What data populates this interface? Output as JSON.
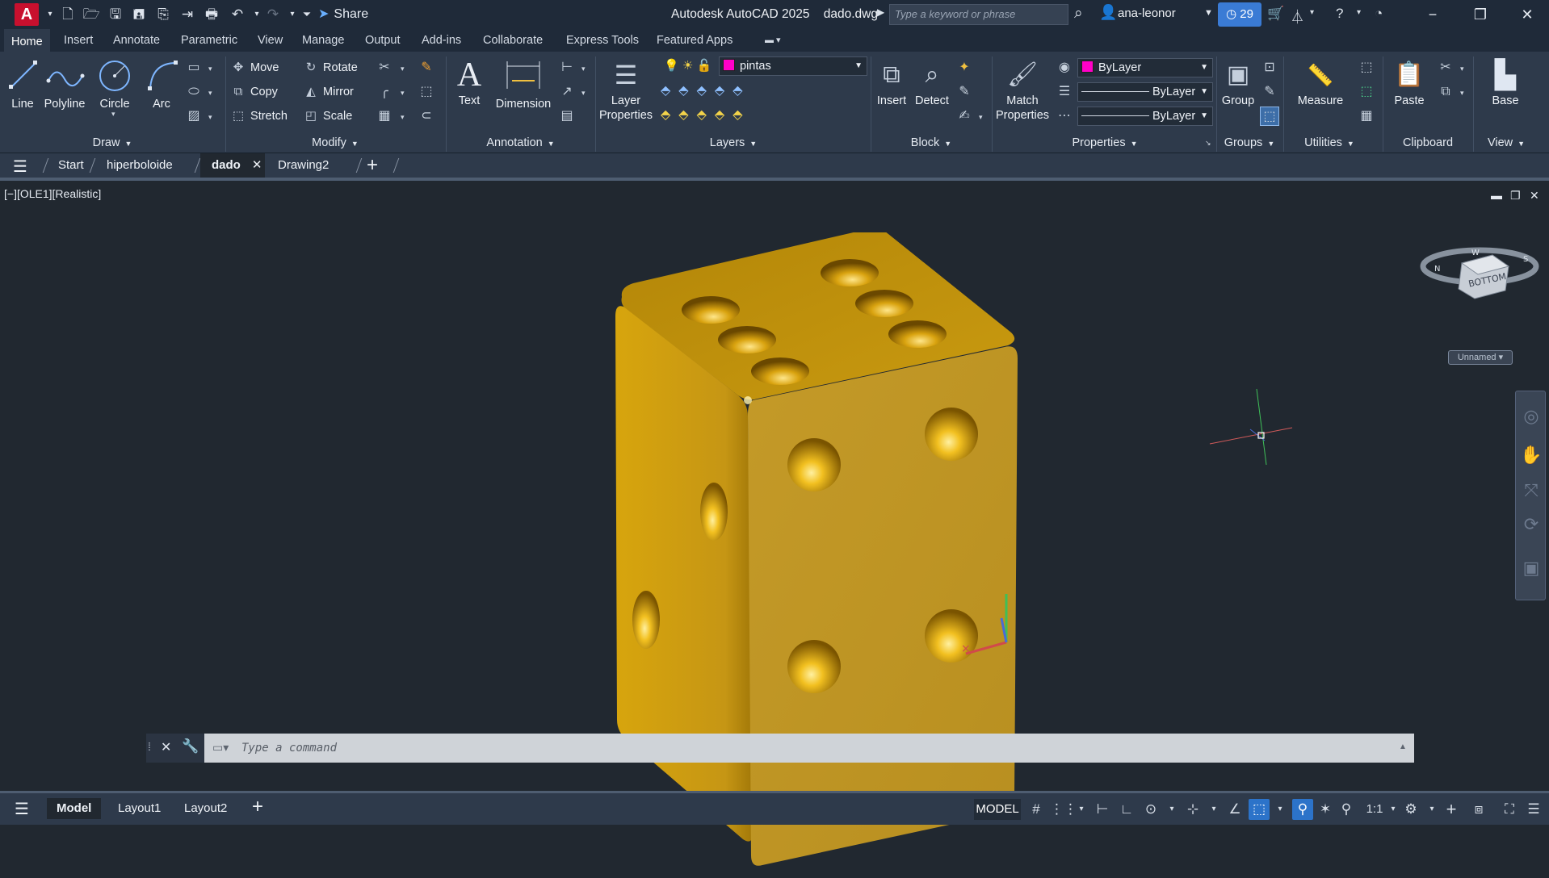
{
  "titlebar": {
    "app_letter": "A",
    "share_label": "Share",
    "app_name": "Autodesk AutoCAD 2025",
    "file_name": "dado.dwg",
    "search_placeholder": "Type a keyword or phrase",
    "user_name": "ana-leonor",
    "subscription_days": "29"
  },
  "ribbon_tabs": [
    "Home",
    "Insert",
    "Annotate",
    "Parametric",
    "View",
    "Manage",
    "Output",
    "Add-ins",
    "Collaborate",
    "Express Tools",
    "Featured Apps"
  ],
  "ribbon": {
    "draw": {
      "title": "Draw",
      "line": "Line",
      "polyline": "Polyline",
      "circle": "Circle",
      "arc": "Arc"
    },
    "modify": {
      "title": "Modify",
      "move": "Move",
      "rotate": "Rotate",
      "copy": "Copy",
      "mirror": "Mirror",
      "stretch": "Stretch",
      "scale": "Scale"
    },
    "annotation": {
      "title": "Annotation",
      "text": "Text",
      "dimension": "Dimension"
    },
    "layers": {
      "title": "Layers",
      "layer_properties_1": "Layer",
      "layer_properties_2": "Properties",
      "current_layer": "pintas",
      "layer_color": "#ff00c8"
    },
    "block": {
      "title": "Block",
      "insert": "Insert",
      "detect": "Detect"
    },
    "properties": {
      "title": "Properties",
      "match_1": "Match",
      "match_2": "Properties",
      "color": "ByLayer",
      "linetype": "ByLayer",
      "lineweight": "ByLayer"
    },
    "groups": {
      "title": "Groups",
      "group": "Group"
    },
    "utilities": {
      "title": "Utilities",
      "measure": "Measure"
    },
    "clipboard": {
      "title": "Clipboard",
      "paste": "Paste"
    },
    "view": {
      "title": "View",
      "base": "Base"
    }
  },
  "doc_tabs": {
    "start": "Start",
    "tab1": "hiperboloide",
    "tab2": "dado",
    "tab3": "Drawing2"
  },
  "viewport": {
    "label": "[−][OLE1][Realistic]",
    "viewcube_face": "BOTTOM",
    "viewcube_named": "Unnamed"
  },
  "command": {
    "placeholder": "Type a command"
  },
  "status": {
    "layout_tabs": [
      "Model",
      "Layout1",
      "Layout2"
    ],
    "model_label": "MODEL",
    "scale": "1:1"
  },
  "colors": {
    "accent": "#3a7bd5",
    "die": "#c99a10",
    "brand": "#c8102e"
  }
}
